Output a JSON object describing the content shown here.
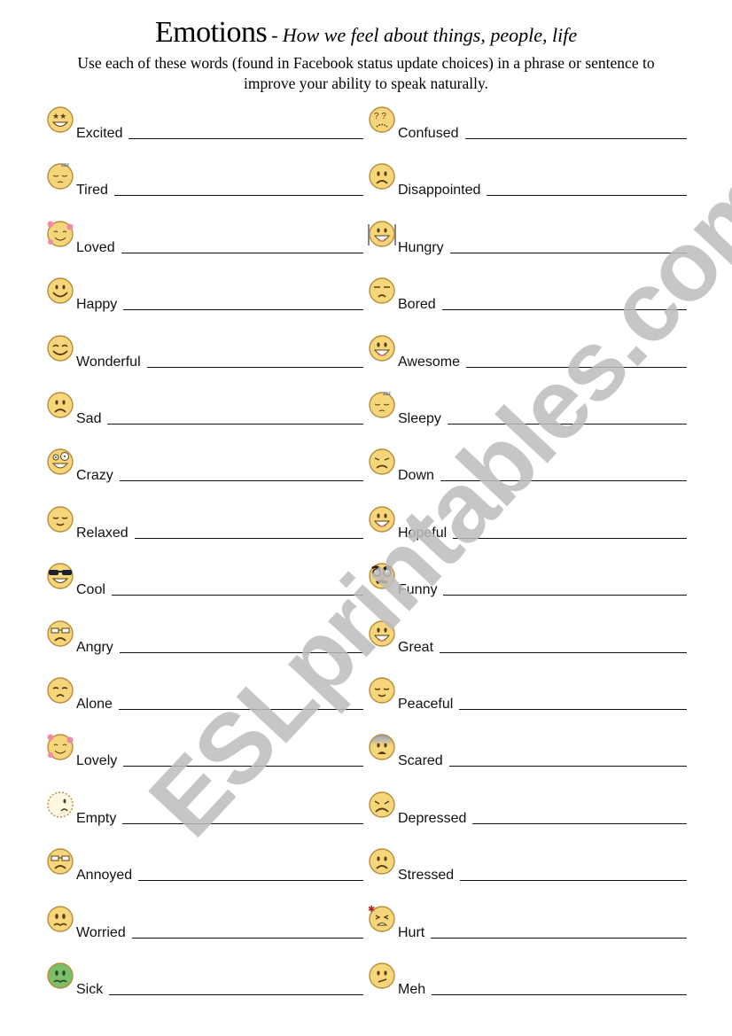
{
  "header": {
    "title": "Emotions",
    "separator": "-",
    "subtitle": "How we feel about things, people, life",
    "instructions": "Use each of these words (found in Facebook status update choices) in a phrase or sentence to improve your ability to speak naturally."
  },
  "watermark": "ESLprintables.com",
  "colors": {
    "face": "#f6d67a",
    "face_edge": "#b98c3a",
    "sick_face": "#7cbf6a",
    "scared_top": "#8aa0d0",
    "heart": "#f08aa8",
    "watermark": "#bdbdbd"
  },
  "left_column": [
    {
      "word": "Excited",
      "icon": "star-eyes-grin-icon"
    },
    {
      "word": "Tired",
      "icon": "sleepy-zzz-icon"
    },
    {
      "word": "Loved",
      "icon": "hearts-smile-icon"
    },
    {
      "word": "Happy",
      "icon": "smile-icon"
    },
    {
      "word": "Wonderful",
      "icon": "happy-closed-eyes-icon"
    },
    {
      "word": "Sad",
      "icon": "sad-icon"
    },
    {
      "word": "Crazy",
      "icon": "crazy-grin-icon"
    },
    {
      "word": "Relaxed",
      "icon": "relaxed-icon"
    },
    {
      "word": "Cool",
      "icon": "sunglasses-icon"
    },
    {
      "word": "Angry",
      "icon": "glasses-frown-icon"
    },
    {
      "word": "Alone",
      "icon": "alone-frown-icon"
    },
    {
      "word": "Lovely",
      "icon": "hearts-smile-icon"
    },
    {
      "word": "Empty",
      "icon": "empty-dotted-face-icon"
    },
    {
      "word": "Annoyed",
      "icon": "glasses-frown-icon"
    },
    {
      "word": "Worried",
      "icon": "worried-icon"
    },
    {
      "word": "Sick",
      "icon": "sick-green-face-icon"
    }
  ],
  "right_column": [
    {
      "word": "Confused",
      "icon": "question-eyes-icon"
    },
    {
      "word": "Disappointed",
      "icon": "sad-icon"
    },
    {
      "word": "Hungry",
      "icon": "fork-knife-grin-icon"
    },
    {
      "word": "Bored",
      "icon": "bored-icon"
    },
    {
      "word": "Awesome",
      "icon": "big-grin-icon"
    },
    {
      "word": "Sleepy",
      "icon": "sleepy-zzz-icon"
    },
    {
      "word": "Down",
      "icon": "down-face-icon"
    },
    {
      "word": "Hopeful",
      "icon": "big-grin-icon"
    },
    {
      "word": "Funny",
      "icon": "disguise-glasses-icon"
    },
    {
      "word": "Great",
      "icon": "big-grin-icon"
    },
    {
      "word": "Peaceful",
      "icon": "relaxed-icon"
    },
    {
      "word": "Scared",
      "icon": "scared-icon"
    },
    {
      "word": "Depressed",
      "icon": "depressed-icon"
    },
    {
      "word": "Stressed",
      "icon": "sad-icon"
    },
    {
      "word": "Hurt",
      "icon": "hurt-star-icon"
    },
    {
      "word": "Meh",
      "icon": "meh-icon"
    }
  ]
}
